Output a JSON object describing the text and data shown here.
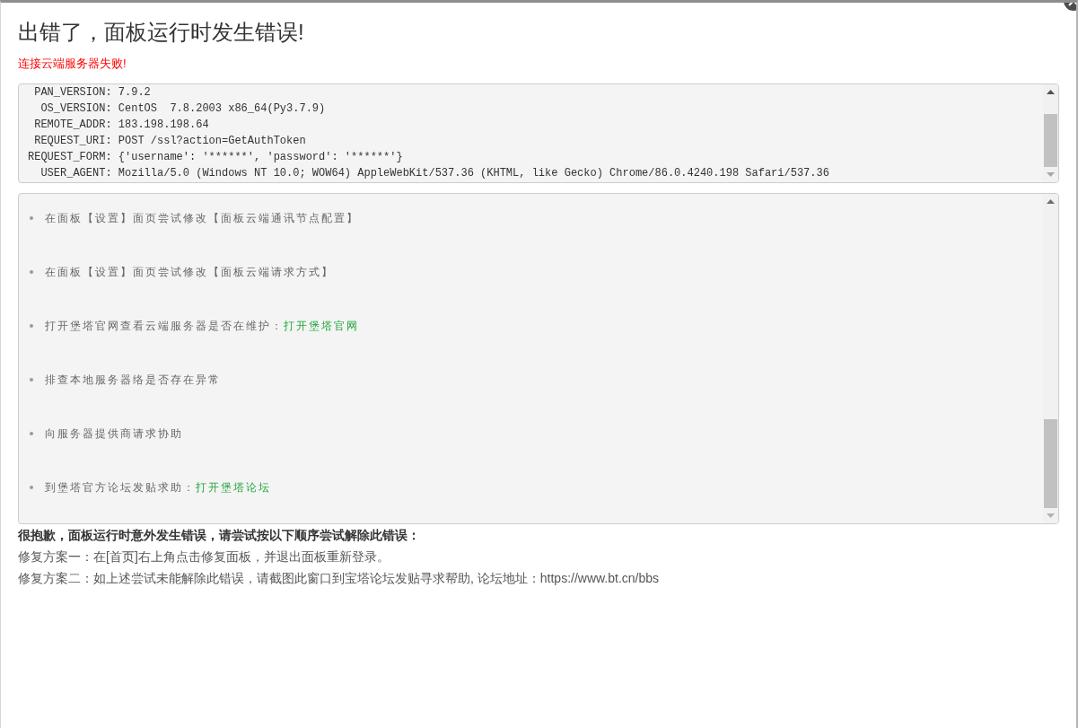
{
  "dialog": {
    "title": "出错了，面板运行时发生错误!",
    "error_message": "连接云端服务器失败!"
  },
  "debug_info": {
    "lines": [
      {
        "key": "PAN_VERSION:",
        "value": "7.9.2"
      },
      {
        "key": "OS_VERSION:",
        "value": "CentOS  7.8.2003 x86_64(Py3.7.9)"
      },
      {
        "key": "REMOTE_ADDR:",
        "value": "183.198.198.64"
      },
      {
        "key": "REQUEST_URI:",
        "value": "POST /ssl?action=GetAuthToken"
      },
      {
        "key": "REQUEST_FORM:",
        "value": "{'username': '******', 'password': '******'}"
      },
      {
        "key": "USER_AGENT:",
        "value": "Mozilla/5.0 (Windows NT 10.0; WOW64) AppleWebKit/537.36 (KHTML, like Gecko) Chrome/86.0.4240.198 Safari/537.36"
      }
    ]
  },
  "suggestions": [
    {
      "text": "在面板【设置】面页尝试修改【面板云端通讯节点配置】"
    },
    {
      "text": "在面板【设置】面页尝试修改【面板云端请求方式】"
    },
    {
      "text": "打开堡塔官网查看云端服务器是否在维护：",
      "link": "打开堡塔官网"
    },
    {
      "text": "排查本地服务器络是否存在异常"
    },
    {
      "text": "向服务器提供商请求协助"
    },
    {
      "text": "到堡塔官方论坛发贴求助：",
      "link": "打开堡塔论坛"
    }
  ],
  "apology": {
    "heading": "很抱歉，面板运行时意外发生错误，请尝试按以下顺序尝试解除此错误：",
    "fixes": [
      "修复方案一：在[首页]右上角点击修复面板，并退出面板重新登录。",
      "修复方案二：如上述尝试未能解除此错误，请截图此窗口到宝塔论坛发贴寻求帮助, 论坛地址：https://www.bt.cn/bbs"
    ]
  }
}
